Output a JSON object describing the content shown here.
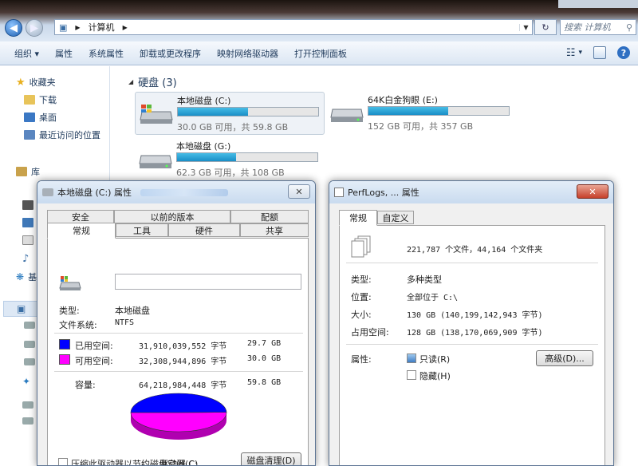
{
  "window": {
    "breadcrumb_root": "计算机",
    "search_placeholder": "搜索 计算机"
  },
  "toolbar": {
    "items": [
      "组织 ▾",
      "属性",
      "系统属性",
      "卸载或更改程序",
      "映射网络驱动器",
      "打开控制面板"
    ],
    "view_label": "▾"
  },
  "sidebar": {
    "favorites": "收藏夹",
    "items": [
      "下载",
      "桌面",
      "最近访问的位置"
    ],
    "libraries": "库",
    "partial": [
      "基"
    ]
  },
  "content": {
    "group_label": "硬盘 (3)",
    "drives": [
      {
        "name": "本地磁盘 (C:)",
        "info": "30.0 GB 可用，共 59.8 GB",
        "used_fraction": 0.5
      },
      {
        "name": "64K白金狗眼 (E:)",
        "info": "152 GB 可用，共 357 GB",
        "used_fraction": 0.57
      },
      {
        "name": "本地磁盘 (G:)",
        "info": "62.3 GB 可用，共 108 GB",
        "used_fraction": 0.42
      }
    ]
  },
  "dialog_c": {
    "title": "本地磁盘 (C:) 属性",
    "tabs_top": [
      "安全",
      "以前的版本",
      "配额"
    ],
    "tabs_bottom": [
      "常规",
      "工具",
      "硬件",
      "共享"
    ],
    "type_label": "类型:",
    "type_value": "本地磁盘",
    "fs_label": "文件系统:",
    "fs_value": "NTFS",
    "used_label": "已用空间:",
    "used_bytes": "31,910,039,552 字节",
    "used_gb": "29.7 GB",
    "free_label": "可用空间:",
    "free_bytes": "32,308,944,896 字节",
    "free_gb": "30.0 GB",
    "cap_label": "容量:",
    "cap_bytes": "64,218,984,448 字节",
    "cap_gb": "59.8 GB",
    "drive_label": "驱动器 C:",
    "cleanup_button": "磁盘清理(D)",
    "compress_label": "压缩此驱动器以节约磁盘空间(C)",
    "used_color": "#0000ff",
    "free_color": "#ff00ff",
    "used_fraction": 0.497
  },
  "dialog_p": {
    "title": "PerfLogs, ... 属性",
    "tabs": [
      "常规",
      "自定义"
    ],
    "count_text": "221,787 个文件，44,164 个文件夹",
    "type_label": "类型:",
    "type_value": "多种类型",
    "loc_label": "位置:",
    "loc_value": "全部位于 C:\\",
    "size_label": "大小:",
    "size_value": "130 GB (140,199,142,943 字节)",
    "disk_label": "占用空间:",
    "disk_value": "128 GB (138,170,069,909 字节)",
    "attr_label": "属性:",
    "readonly_label": "只读(R)",
    "hidden_label": "隐藏(H)",
    "advanced_button": "高级(D)..."
  }
}
